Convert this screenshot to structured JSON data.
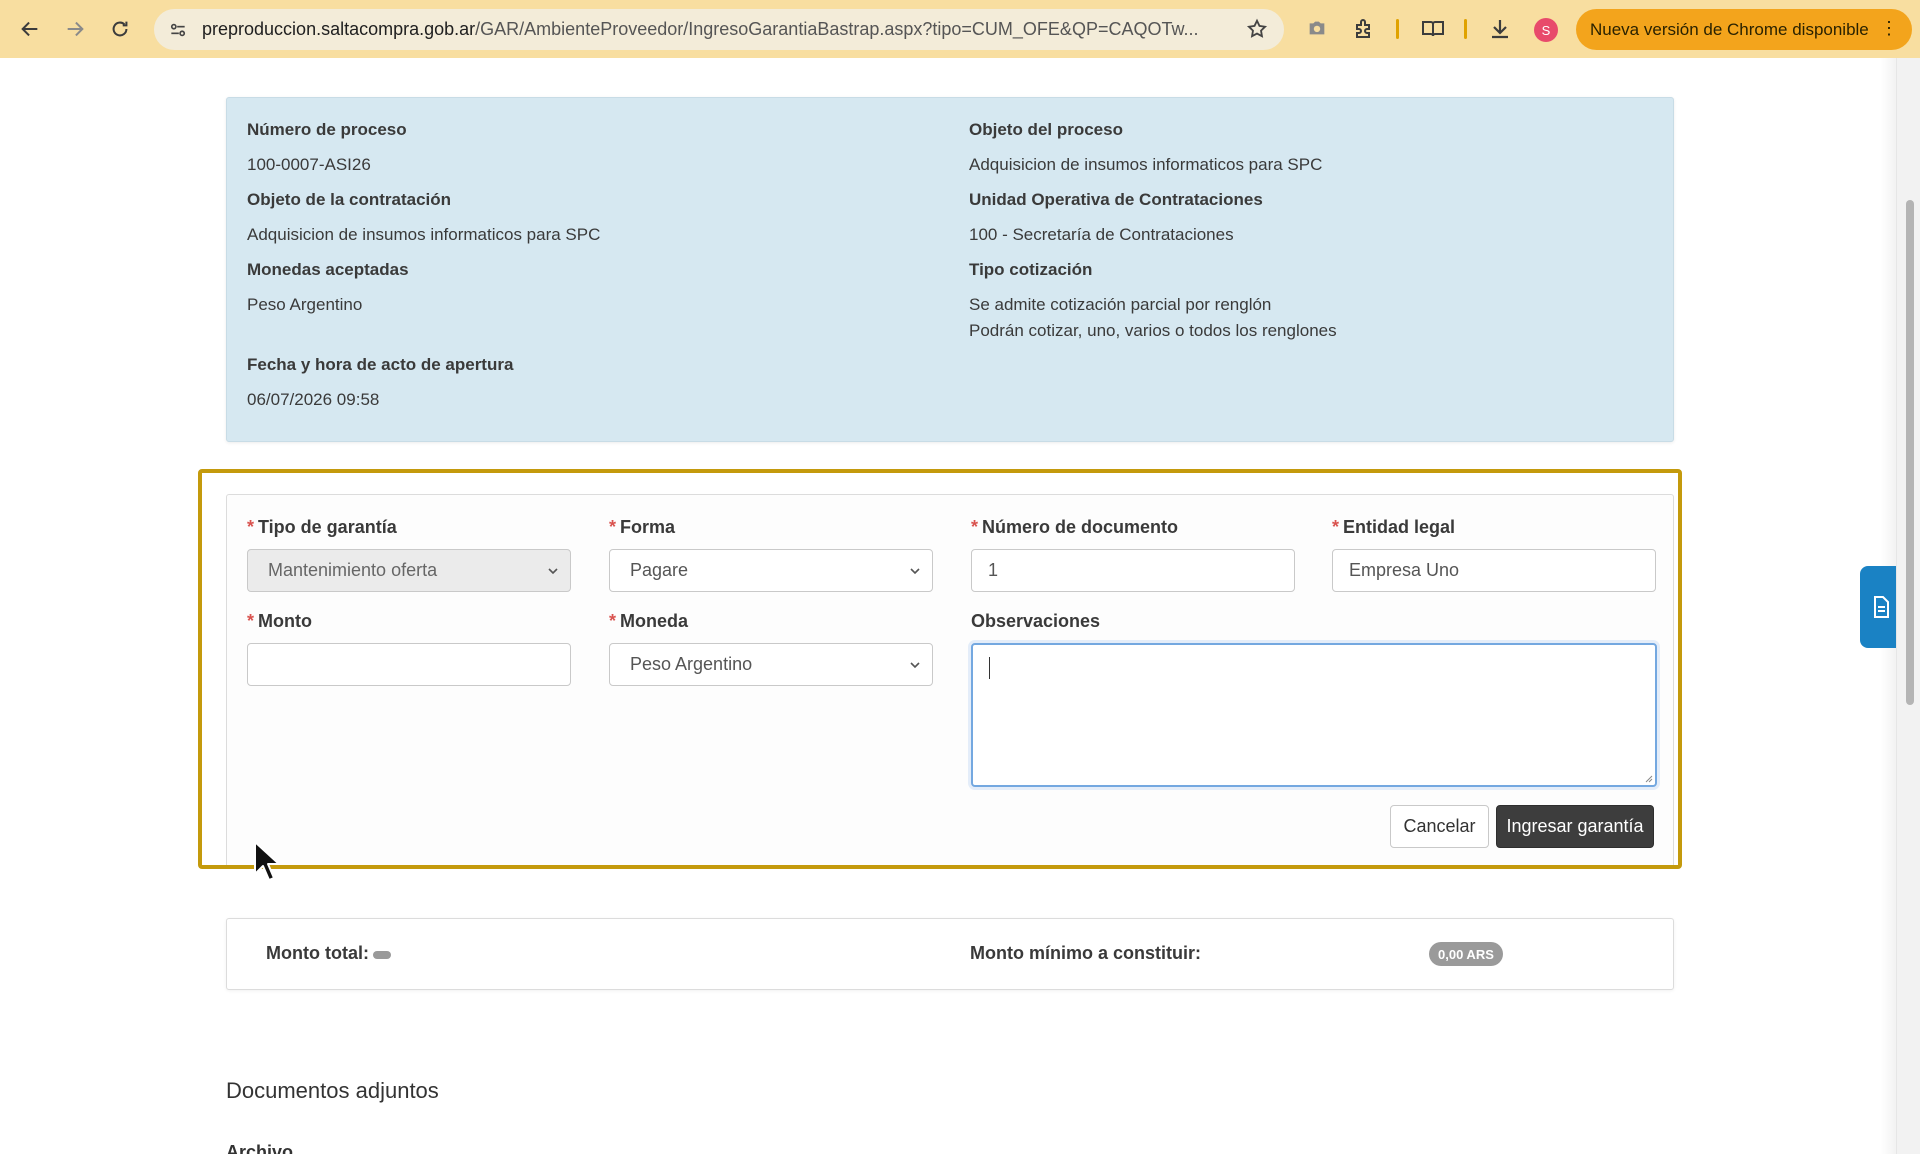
{
  "browser": {
    "url_host": "preproduccion.saltacompra.gob.ar",
    "url_path": "/GAR/AmbienteProveedor/IngresoGarantiaBastrap.aspx?tipo=CUM_OFE&QP=CAQOTw...",
    "profile_initial": "S",
    "update_label": "Nueva versión de Chrome disponible"
  },
  "process_info": {
    "numero_label": "Número de proceso",
    "numero_value": "100-0007-ASI26",
    "objeto_proceso_label": "Objeto del proceso",
    "objeto_proceso_value": "Adquisicion de insumos informaticos para SPC",
    "objeto_contratacion_label": "Objeto de la contratación",
    "objeto_contratacion_value": "Adquisicion de insumos informaticos para SPC",
    "unidad_label": "Unidad Operativa de Contrataciones",
    "unidad_value": "100 - Secretaría de Contrataciones",
    "monedas_label": "Monedas aceptadas",
    "monedas_value": "Peso Argentino",
    "tipo_cotizacion_label": "Tipo cotización",
    "tipo_cotizacion_value_1": "Se admite cotización parcial por renglón",
    "tipo_cotizacion_value_2": "Podrán cotizar, uno, varios o todos los renglones",
    "fecha_label": "Fecha y hora de acto de apertura",
    "fecha_value": "06/07/2026 09:58"
  },
  "form": {
    "required_mark": "*",
    "tipo_garantia_label": "Tipo de garantía",
    "tipo_garantia_value": "Mantenimiento oferta",
    "forma_label": "Forma",
    "forma_value": "Pagare",
    "numero_documento_label": "Número de documento",
    "numero_documento_value": "1",
    "entidad_label": "Entidad legal",
    "entidad_value": "Empresa Uno",
    "monto_label": "Monto",
    "monto_value": "",
    "moneda_label": "Moneda",
    "moneda_value": "Peso Argentino",
    "observaciones_label": "Observaciones",
    "observaciones_value": "",
    "cancel_label": "Cancelar",
    "submit_label": "Ingresar garantía"
  },
  "totals": {
    "monto_total_label": "Monto total:",
    "monto_minimo_label": "Monto mínimo a constituir:",
    "monto_minimo_value": "0,00 ARS"
  },
  "documents": {
    "title": "Documentos adjuntos",
    "archivo_label": "Archivo"
  },
  "colors": {
    "toolbar": "#f8dea0",
    "update_pill": "#f3a41c",
    "info_panel": "#d6e8f1",
    "highlight": "#c49a0c",
    "primary_button": "#3d3d3d",
    "side_tab": "#1a82c4"
  }
}
